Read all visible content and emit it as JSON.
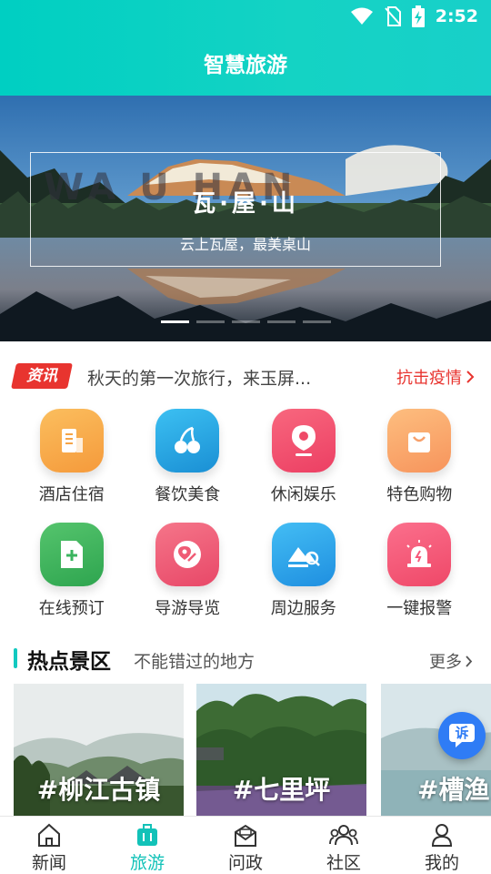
{
  "status_bar": {
    "time": "2:52",
    "icons": [
      "wifi-icon",
      "no-sim-icon",
      "battery-charging-icon"
    ]
  },
  "header": {
    "title": "智慧旅游"
  },
  "banner": {
    "background_word": "WA    U    HAN",
    "title": "瓦·屋·山",
    "subtitle": "云上瓦屋，最美桌山",
    "slides": 5,
    "active_slide": 1
  },
  "news": {
    "badge": "资讯",
    "headline": "秋天的第一次旅行，来玉屏...",
    "category": "抗击疫情"
  },
  "services": [
    {
      "label": "酒店住宿",
      "icon": "hotel-icon",
      "color": "#f7a547"
    },
    {
      "label": "餐饮美食",
      "icon": "cherry-icon",
      "color": "#1fa4e0"
    },
    {
      "label": "休闲娱乐",
      "icon": "location-pin-icon",
      "color": "#f2506f"
    },
    {
      "label": "特色购物",
      "icon": "shopping-bag-icon",
      "color": "#f9a86b"
    },
    {
      "label": "在线预订",
      "icon": "booking-icon",
      "color": "#3bb55f"
    },
    {
      "label": "导游导览",
      "icon": "map-pin-icon",
      "color": "#ef5b74"
    },
    {
      "label": "周边服务",
      "icon": "nearby-search-icon",
      "color": "#29a8ec"
    },
    {
      "label": "一键报警",
      "icon": "alarm-light-icon",
      "color": "#f7587a"
    }
  ],
  "hot_spots": {
    "title": "热点景区",
    "subtitle": "不能错过的地方",
    "more": "更多",
    "items": [
      {
        "name": "#柳江古镇"
      },
      {
        "name": "#七里坪"
      },
      {
        "name": "#槽渔"
      }
    ]
  },
  "float_button": {
    "label": "诉"
  },
  "tabs": [
    {
      "label": "新闻",
      "icon": "home-icon",
      "active": false
    },
    {
      "label": "旅游",
      "icon": "luggage-icon",
      "active": true
    },
    {
      "label": "问政",
      "icon": "mail-icon",
      "active": false
    },
    {
      "label": "社区",
      "icon": "community-icon",
      "active": false
    },
    {
      "label": "我的",
      "icon": "user-icon",
      "active": false
    }
  ]
}
